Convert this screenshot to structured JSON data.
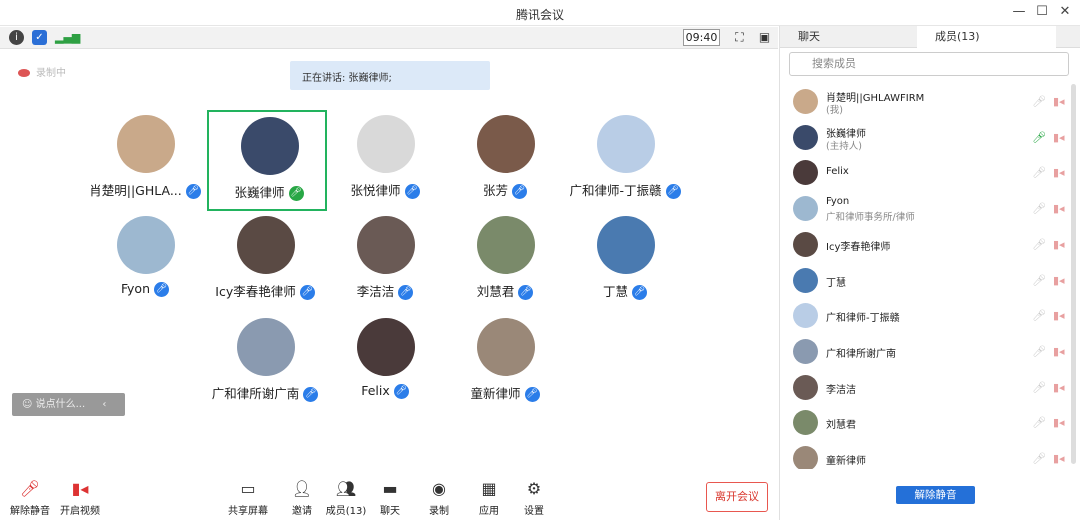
{
  "window": {
    "title": "腾讯会议",
    "minimize": "—",
    "maximize": "☐",
    "close": "✕"
  },
  "toolbar": {
    "time": "09:40"
  },
  "status": {
    "recording": "录制中",
    "speaking": "正在讲话: 张巍律师;"
  },
  "participants_grid": [
    {
      "name": "肖楚明||GHLA...",
      "color": "#c9a98a"
    },
    {
      "name": "张巍律师",
      "color": "#3a4a6a",
      "active": true
    },
    {
      "name": "张悦律师",
      "color": "#d9d9d9"
    },
    {
      "name": "张芳",
      "color": "#7a5a4a"
    },
    {
      "name": "广和律师-丁振赣",
      "color": "#b9cde6"
    },
    {
      "name": "Fyon",
      "color": "#9db8d0"
    },
    {
      "name": "Icy李春艳律师",
      "color": "#5a4a44"
    },
    {
      "name": "李洁洁",
      "color": "#6a5a55"
    },
    {
      "name": "刘慧君",
      "color": "#7a8a6a"
    },
    {
      "name": "丁慧",
      "color": "#4a7ab0"
    },
    {
      "name": "广和律所谢广南",
      "color": "#8a9ab0"
    },
    {
      "name": "Felix",
      "color": "#4a3a3a"
    },
    {
      "name": "童新律师",
      "color": "#9a8878"
    }
  ],
  "chat_input": {
    "placeholder": "说点什么...",
    "toggle": "‹"
  },
  "bottom": {
    "unmute": "解除静音",
    "video": "开启视频",
    "share": "共享屏幕",
    "invite": "邀请",
    "members": "成员(13)",
    "chat": "聊天",
    "record": "录制",
    "apps": "应用",
    "settings": "设置",
    "leave": "离开会议"
  },
  "panel": {
    "tab_chat": "聊天",
    "tab_members": "成员(13)",
    "search_placeholder": "搜索成员",
    "unmute_all": "解除静音",
    "members": [
      {
        "name": "肖楚明||GHLAWFIRM",
        "sub": "(我)",
        "color": "#c9a98a"
      },
      {
        "name": "张巍律师",
        "sub": "(主持人)",
        "color": "#3a4a6a",
        "mic_on": true
      },
      {
        "name": "Felix",
        "sub": "",
        "color": "#4a3a3a"
      },
      {
        "name": "Fyon",
        "sub": "广和律师事务所/律师",
        "color": "#9db8d0"
      },
      {
        "name": "Icy李春艳律师",
        "sub": "",
        "color": "#5a4a44"
      },
      {
        "name": "丁慧",
        "sub": "",
        "color": "#4a7ab0"
      },
      {
        "name": "广和律师-丁振赣",
        "sub": "",
        "color": "#b9cde6"
      },
      {
        "name": "广和律所谢广南",
        "sub": "",
        "color": "#8a9ab0"
      },
      {
        "name": "李洁洁",
        "sub": "",
        "color": "#6a5a55"
      },
      {
        "name": "刘慧君",
        "sub": "",
        "color": "#7a8a6a"
      },
      {
        "name": "童新律师",
        "sub": "",
        "color": "#9a8878"
      }
    ]
  }
}
